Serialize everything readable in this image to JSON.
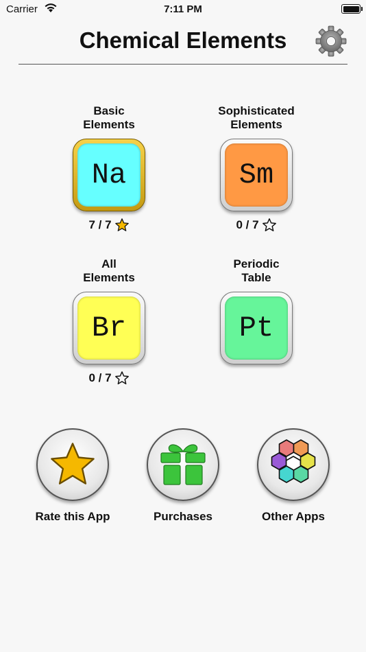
{
  "status_bar": {
    "carrier": "Carrier",
    "time": "7:11 PM"
  },
  "header": {
    "title": "Chemical Elements"
  },
  "tiles": [
    {
      "label_line1": "Basic",
      "label_line2": "Elements",
      "symbol": "Na",
      "color": "#66ffff",
      "score": "7 / 7",
      "star": "filled"
    },
    {
      "label_line1": "Sophisticated",
      "label_line2": "Elements",
      "symbol": "Sm",
      "color": "#ff9944",
      "score": "0 / 7",
      "star": "outline"
    },
    {
      "label_line1": "All",
      "label_line2": "Elements",
      "symbol": "Br",
      "color": "#ffff55",
      "score": "0 / 7",
      "star": "outline"
    },
    {
      "label_line1": "Periodic",
      "label_line2": "Table",
      "symbol": "Pt",
      "color": "#66f59a"
    }
  ],
  "bottom_buttons": [
    {
      "label": "Rate this App",
      "icon": "star-icon"
    },
    {
      "label": "Purchases",
      "icon": "gift-icon"
    },
    {
      "label": "Other Apps",
      "icon": "hexagons-icon"
    }
  ],
  "colors": {
    "accent_gold": "#f5b800",
    "gift_green": "#3cc43c"
  }
}
